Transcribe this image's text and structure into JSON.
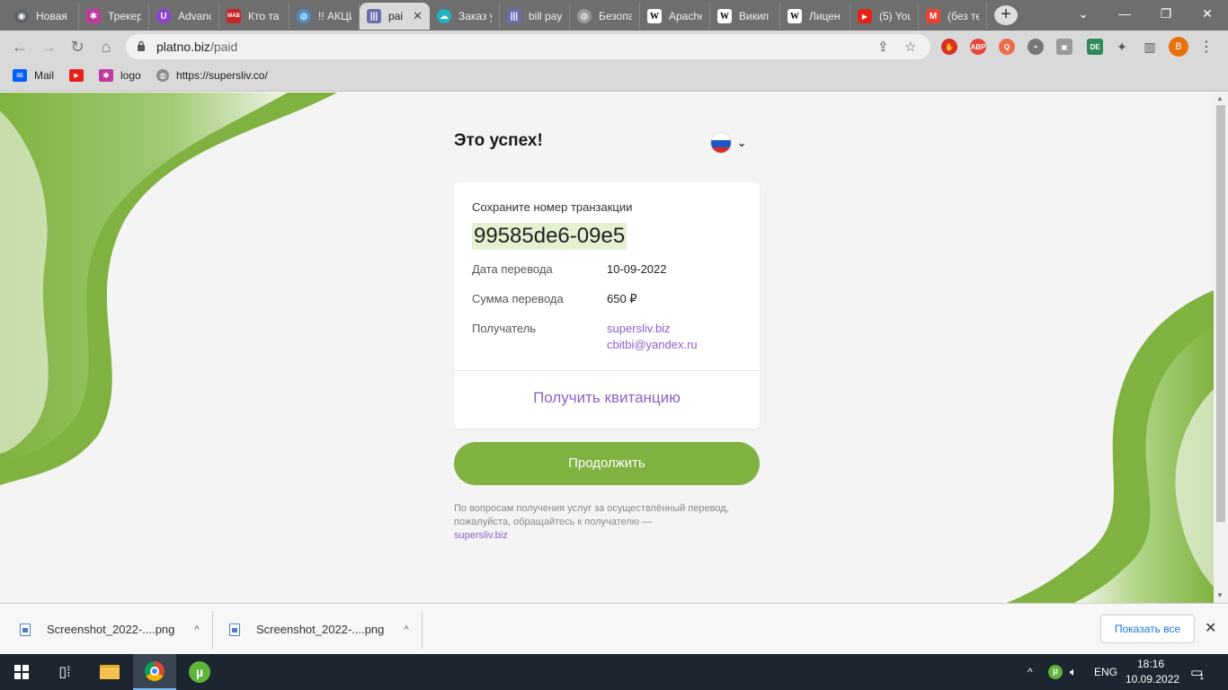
{
  "browser": {
    "tabs": [
      {
        "title": "Новая",
        "icon": "chrome-icon",
        "color": "#5f6368"
      },
      {
        "title": "Трекер",
        "icon": "star-icon",
        "color": "#c0399c"
      },
      {
        "title": "Advanc",
        "icon": "shield-icon",
        "color": "#8e3fd6"
      },
      {
        "title": "Кто та",
        "icon": "mab-icon",
        "color": "#c62828"
      },
      {
        "title": "!! АКЦИ",
        "icon": "globe-icon",
        "color": "#4a90c2"
      },
      {
        "title": "pai",
        "icon": "barcode-icon",
        "color": "#6b6bb0",
        "active": true
      },
      {
        "title": "Заказ у",
        "icon": "cloud-icon",
        "color": "#22b4c6"
      },
      {
        "title": "bill pay",
        "icon": "barcode-icon",
        "color": "#6b6bb0"
      },
      {
        "title": "Безопа",
        "icon": "globe-icon",
        "color": "#999999"
      },
      {
        "title": "Apache",
        "icon": "wikipedia-icon",
        "color": "#ffffff"
      },
      {
        "title": "Викип",
        "icon": "wikipedia-icon",
        "color": "#ffffff"
      },
      {
        "title": "Лицен",
        "icon": "wikipedia-icon",
        "color": "#ffffff"
      },
      {
        "title": "(5) You",
        "icon": "youtube-icon",
        "color": "#e62117"
      },
      {
        "title": "(без те",
        "icon": "gmail-icon",
        "color": "#ea4335"
      }
    ],
    "address": {
      "domain": "platno.biz",
      "path": "/paid"
    },
    "bookmarks": [
      {
        "label": "Mail",
        "icon": "mail-icon",
        "color": "#005ff9"
      },
      {
        "label": "",
        "icon": "youtube-icon",
        "color": "#e62117"
      },
      {
        "label": "logo",
        "icon": "logo-icon",
        "color": "#c0399c"
      },
      {
        "label": "https://supersliv.co/",
        "icon": "globe-icon",
        "color": "#8a8a8a"
      }
    ],
    "profile_letter": "B"
  },
  "page": {
    "title": "Это успех!",
    "save_label": "Сохраните номер транзакции",
    "transaction_id": "99585de6-09e5",
    "rows": {
      "date_label": "Дата перевода",
      "date_value": "10-09-2022",
      "amount_label": "Сумма перевода",
      "amount_value": "650 ₽",
      "recipient_label": "Получатель",
      "recipient_site": "supersliv.biz",
      "recipient_email": "cbitbi@yandex.ru"
    },
    "receipt_link": "Получить квитанцию",
    "continue_button": "Продолжить",
    "note_text": "По вопросам получения услуг за осуществлённый перевод, пожалуйста, обращайтесь к получателю —",
    "note_link": "supersliv.biz",
    "accent_green": "#7fb240",
    "accent_purple": "#8e5fc8"
  },
  "downloads": {
    "items": [
      {
        "name": "Screenshot_2022-....png"
      },
      {
        "name": "Screenshot_2022-....png"
      }
    ],
    "show_all": "Показать все"
  },
  "taskbar": {
    "lang": "ENG",
    "time": "18:16",
    "date": "10.09.2022",
    "notifications": "1"
  }
}
